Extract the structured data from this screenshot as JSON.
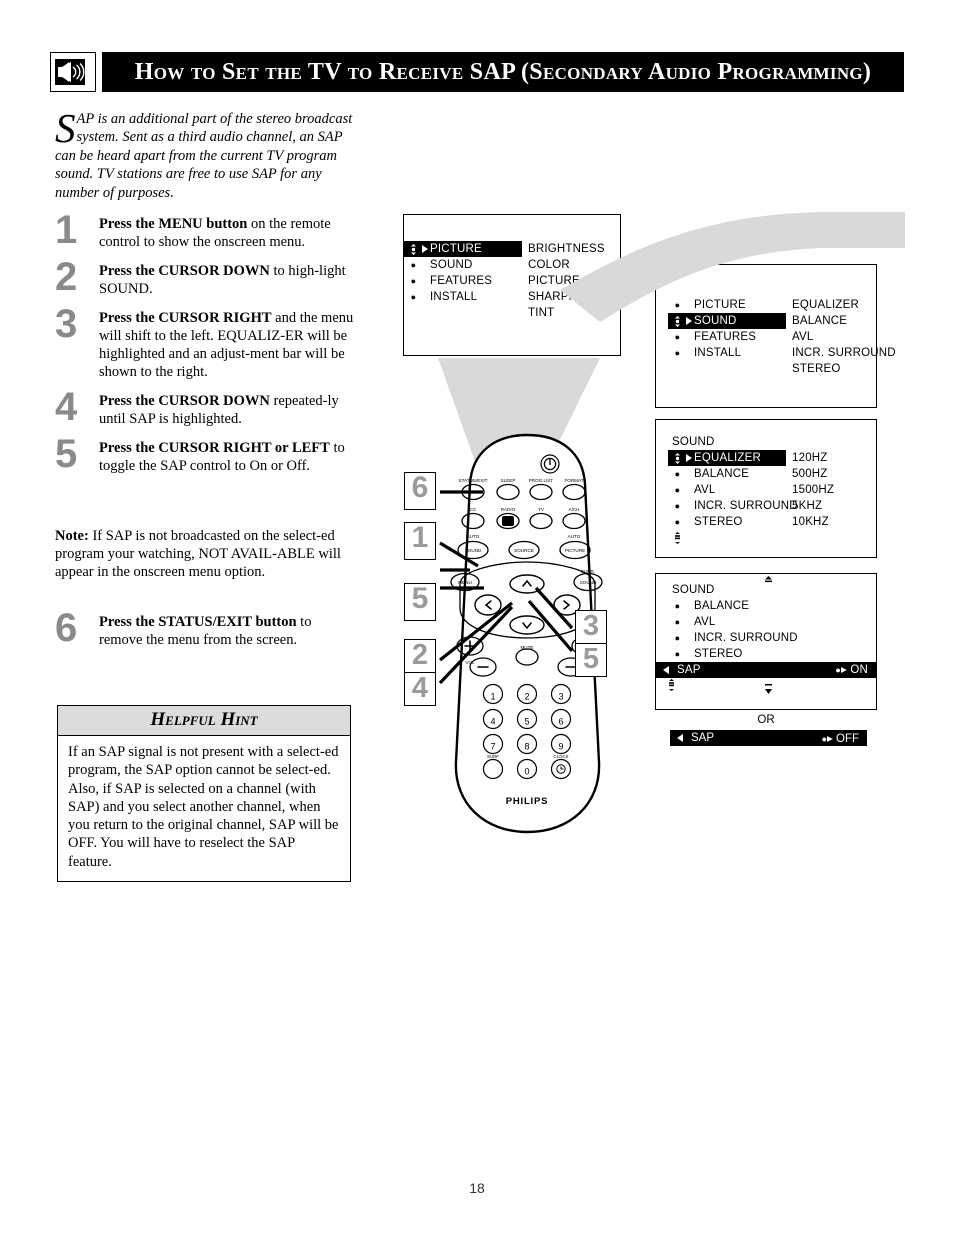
{
  "header": {
    "icon": "speaker-sound-icon",
    "title": "How to Set the TV to Receive SAP (Secondary Audio Programming)"
  },
  "intro": {
    "dropcap": "S",
    "text": "AP is an additional part of the stereo broadcast system.  Sent as a third audio channel, an SAP can be heard apart from the current TV program sound.  TV stations are free to use SAP for any number of purposes."
  },
  "steps": [
    {
      "num": "1",
      "bold": "Press the MENU button",
      "rest": " on the remote control to show the onscreen menu."
    },
    {
      "num": "2",
      "bold": "Press the CURSOR DOWN",
      "rest": " to high-light SOUND."
    },
    {
      "num": "3",
      "bold": "Press the CURSOR RIGHT",
      "rest": " and the menu will shift to the left. EQUALIZ-ER will be highlighted and an adjust-ment bar will be shown to the right."
    },
    {
      "num": "4",
      "bold": "Press the CURSOR DOWN",
      "rest": " repeated-ly until SAP is highlighted."
    },
    {
      "num": "5",
      "bold": "Press the CURSOR RIGHT or LEFT",
      "rest": " to toggle the SAP control to On or Off."
    }
  ],
  "note": {
    "label": "Note:",
    "text": " If SAP is not broadcasted on the select-ed program your watching, NOT AVAIL-ABLE will appear in the onscreen menu option."
  },
  "step6": {
    "num": "6",
    "bold": "Press the STATUS/EXIT button",
    "rest": " to remove the menu from the screen."
  },
  "hint": {
    "title": "Helpful Hint",
    "body": "If an SAP signal is not present with a select-ed program, the SAP option cannot be select-ed.  Also, if SAP is selected on a channel (with SAP) and you select another channel, when you return to the original channel, SAP will be OFF.  You will have to reselect the SAP feature."
  },
  "osd": {
    "panel1": {
      "left": [
        {
          "label": "PICTURE",
          "highlighted": true
        },
        {
          "label": "SOUND",
          "highlighted": false
        },
        {
          "label": "FEATURES",
          "highlighted": false
        },
        {
          "label": "INSTALL",
          "highlighted": false
        }
      ],
      "right": [
        "BRIGHTNESS",
        "COLOR",
        "PICTURE",
        "SHARPNESS",
        "TINT"
      ]
    },
    "panel2": {
      "left": [
        {
          "label": "PICTURE",
          "highlighted": false
        },
        {
          "label": "SOUND",
          "highlighted": true
        },
        {
          "label": "FEATURES",
          "highlighted": false
        },
        {
          "label": "INSTALL",
          "highlighted": false
        }
      ],
      "right": [
        "EQUALIZER",
        "BALANCE",
        "AVL",
        "INCR.  SURROUND",
        "STEREO"
      ]
    },
    "panel3": {
      "title": "SOUND",
      "left": [
        {
          "label": "EQUALIZER",
          "highlighted": true
        },
        {
          "label": "BALANCE",
          "highlighted": false
        },
        {
          "label": "AVL",
          "highlighted": false
        },
        {
          "label": "INCR.  SURROUND",
          "highlighted": false
        },
        {
          "label": "STEREO",
          "highlighted": false
        }
      ],
      "right": [
        "120HZ",
        "500HZ",
        "1500HZ",
        "5KHZ",
        "10KHZ"
      ]
    },
    "panel4": {
      "title": "SOUND",
      "items": [
        "BALANCE",
        "AVL",
        "INCR.  SURROUND",
        "STEREO"
      ],
      "sap_label": "SAP",
      "sap_value": "ON",
      "or_label": "OR",
      "sap_off_label": "SAP",
      "sap_off_value": "OFF"
    }
  },
  "callouts": {
    "left": [
      "6",
      "1",
      "5",
      "2",
      "4"
    ],
    "right": [
      "3",
      "5"
    ]
  },
  "remote": {
    "brand": "PHILIPS",
    "row1": [
      "STATUS/EXIT",
      "SLEEP",
      "PROG.LIST",
      "FORMAT"
    ],
    "row2": [
      "CC",
      "RADIO",
      "TV",
      "A/CH"
    ],
    "row3_labels": [
      "AUTO",
      "AUTO"
    ],
    "row3": [
      "SOUND",
      "SOURCE",
      "PICTURE"
    ],
    "menu_label": "MENU",
    "surr_label": "SURR.",
    "surr_button": "SOUND",
    "mute_label": "MUTE",
    "vol_label": "VOL",
    "ch_label": "CH",
    "keys": [
      "1",
      "2",
      "3",
      "4",
      "5",
      "6",
      "7",
      "8",
      "9",
      "0"
    ],
    "surf_label": "SURF",
    "clock_label": "CLOCK"
  },
  "page_number": "18",
  "colors": {
    "accent_gray": "#8a8a8a",
    "shape_gray": "#d9d9d9",
    "hint_head": "#dcdcdc",
    "black": "#000000"
  }
}
